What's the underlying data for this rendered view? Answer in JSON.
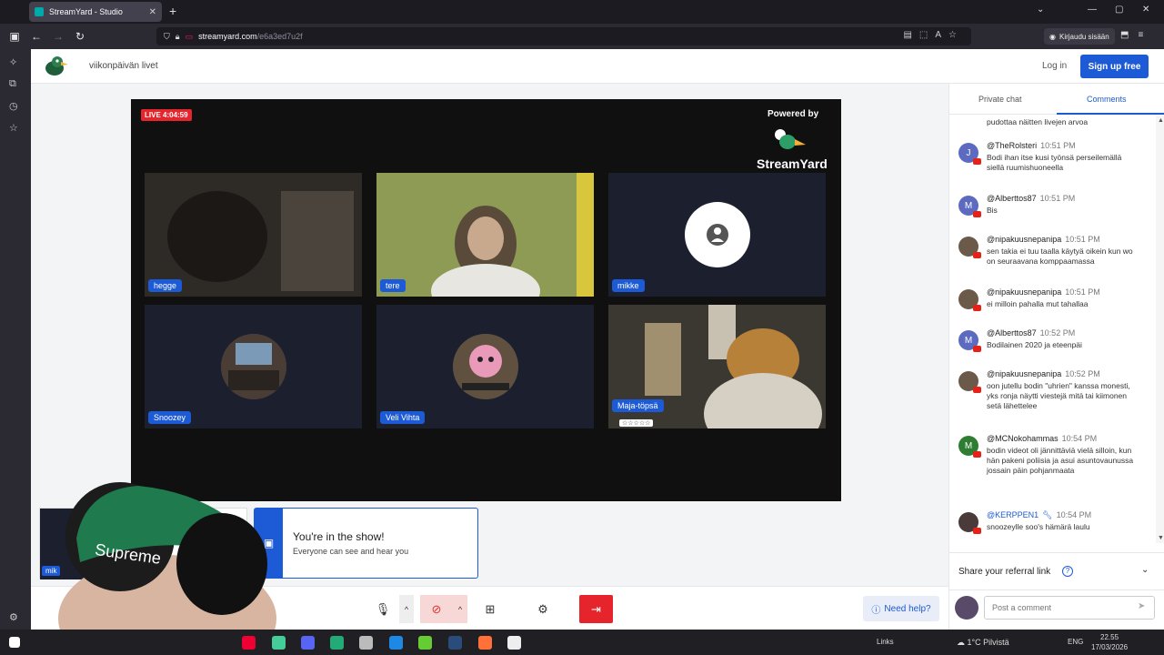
{
  "browser": {
    "tab_title": "StreamYard - Studio",
    "url_host": "streamyard.com",
    "url_path": "/e6a3ed7u2f",
    "signin_label": "Kirjaudu sisään"
  },
  "header": {
    "broadcast_title": "viikonpäivän livet",
    "login_label": "Log in",
    "signup_label": "Sign up free"
  },
  "stage": {
    "live_label": "LIVE 4:04:59",
    "powered_by": "Powered by",
    "brand": "StreamYard",
    "participants": [
      {
        "name": "hegge"
      },
      {
        "name": "tere"
      },
      {
        "name": "mikke"
      },
      {
        "name": "Snoozey"
      },
      {
        "name": "Veli Vihta"
      },
      {
        "name": "Maja-töpsä"
      }
    ],
    "stars": "☆☆☆☆☆"
  },
  "self": {
    "name": "mik"
  },
  "toast": {
    "title": "You're in the show!",
    "subtitle": "Everyone can see and hear you"
  },
  "controls": {
    "help_label": "Need help?"
  },
  "chat": {
    "tab_private": "Private chat",
    "tab_comments": "Comments",
    "partial_top": "pudottaa näitten livejen arvoa",
    "comments": [
      {
        "initial": "J",
        "color": "#5c6bc0",
        "name": "@TheRolsteri",
        "time": "10:51 PM",
        "text": "Bodi ihan itse kusi työnsä perseilemällä siellä ruumishuoneella"
      },
      {
        "initial": "M",
        "color": "#5c6bc0",
        "name": "@Alberttos87",
        "time": "10:51 PM",
        "text": "Bis"
      },
      {
        "initial": "",
        "color": "#6b5a4a",
        "name": "@nipakuusnepanipa",
        "time": "10:51 PM",
        "text": "sen takia ei tuu taalla käytyä oikein kun wo on seuraavana komppaamassa"
      },
      {
        "initial": "",
        "color": "#6b5a4a",
        "name": "@nipakuusnepanipa",
        "time": "10:51 PM",
        "text": "ei milloin pahalla mut tahallaa"
      },
      {
        "initial": "M",
        "color": "#5c6bc0",
        "name": "@Alberttos87",
        "time": "10:52 PM",
        "text": "Bodilainen 2020 ja eteenpäi"
      },
      {
        "initial": "",
        "color": "#6b5a4a",
        "name": "@nipakuusnepanipa",
        "time": "10:52 PM",
        "text": "oon jutellu bodin \"uhrien\" kanssa monesti, yks ronja näytti viestejä mitä tai kiimonen setä lähettelee"
      },
      {
        "initial": "M",
        "color": "#2e7d32",
        "name": "@MCNokohammas",
        "time": "10:54 PM",
        "text": "bodin videot oli jännittäviä vielä silloin, kun hän pakeni poliisia ja asui asuntovaunussa jossain päin pohjanmaata"
      },
      {
        "initial": "",
        "color": "#4a3a3a",
        "name": "@KERPPEN1",
        "time": "10:54 PM",
        "text": "snoozeylle soo's hämärä laulu"
      }
    ],
    "referral_label": "Share your referral link",
    "post_placeholder": "Post a comment"
  },
  "taskbar": {
    "tray_label": "Links",
    "weather": "1°C Pilvistä",
    "lang": "ENG",
    "time": "22.55",
    "date": "17/03/2026"
  }
}
